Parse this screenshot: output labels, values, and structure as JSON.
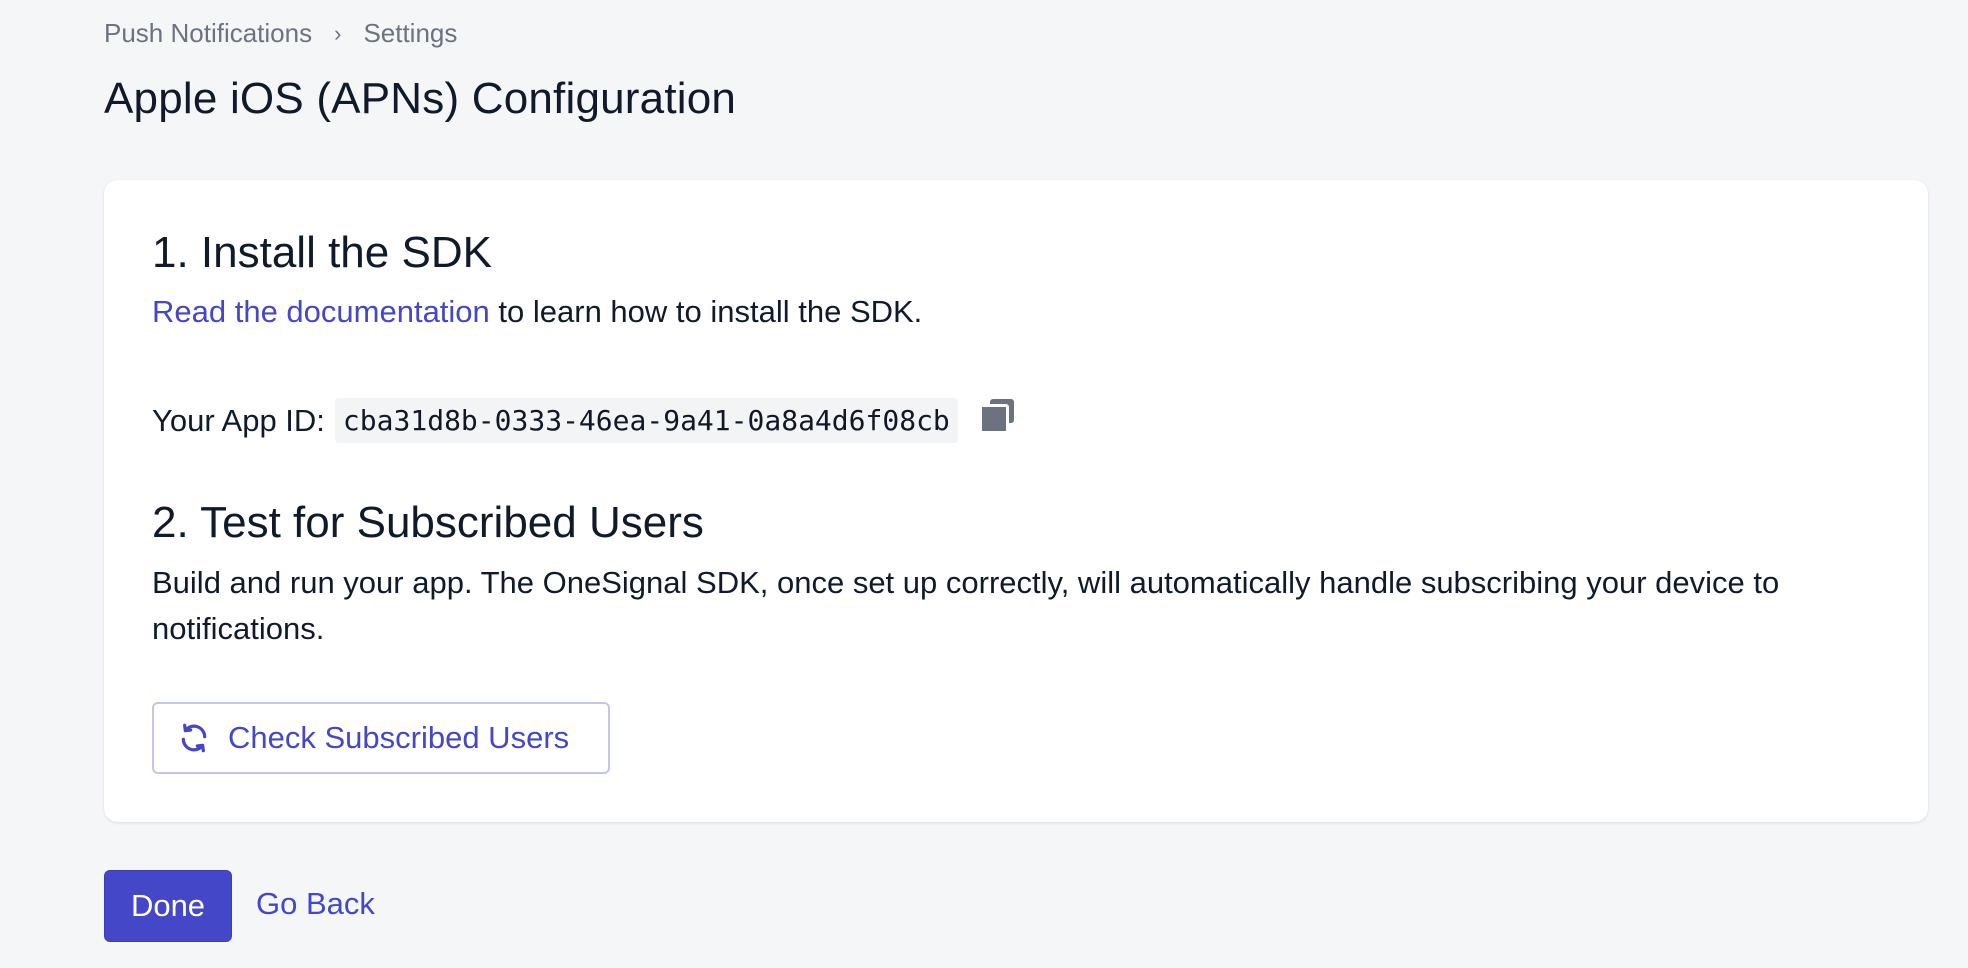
{
  "breadcrumb": {
    "items": [
      "Push Notifications",
      "Settings"
    ],
    "separator": "›"
  },
  "page_title": "Apple iOS (APNs) Configuration",
  "step1": {
    "heading": "1. Install the SDK",
    "link_text": "Read the documentation",
    "text_after_link": " to learn how to install the SDK.",
    "app_id_label": "Your App ID:",
    "app_id_value": "cba31d8b-0333-46ea-9a41-0a8a4d6f08cb",
    "copy_icon": "copy-icon"
  },
  "step2": {
    "heading": "2. Test for Subscribed Users",
    "description": "Build and run your app. The OneSignal SDK, once set up correctly, will automatically handle subscribing your device to notifications.",
    "check_button_label": "Check Subscribed Users",
    "check_button_icon": "refresh-icon"
  },
  "footer": {
    "done_label": "Done",
    "go_back_label": "Go Back"
  },
  "colors": {
    "accent": "#4447c7",
    "background": "#f5f6f8",
    "card": "#ffffff",
    "text": "#0f1a2a",
    "muted": "#6b7280"
  }
}
